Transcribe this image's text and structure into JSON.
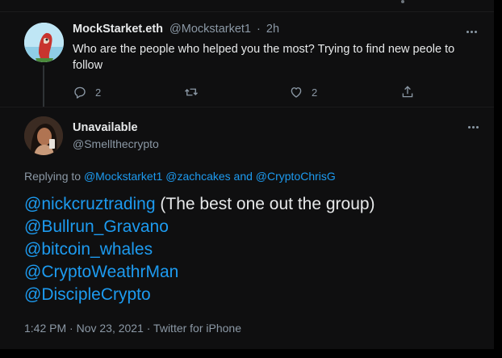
{
  "parent_tweet": {
    "display_name": "MockStarket.eth",
    "handle": "@Mockstarket1",
    "separator": "·",
    "time": "2h",
    "text": "Who are the people who helped you the most? Trying to find new peole to follow",
    "reply_count": "2",
    "retweet_count": "",
    "like_count": "2"
  },
  "reply_tweet": {
    "display_name": "Unavailable",
    "handle": "@Smellthecrypto",
    "replying_prefix": "Replying to",
    "replying_users": "@Mockstarket1 @zachcakes and @CryptoChrisG",
    "lines": [
      {
        "mention": "@nickcruztrading",
        "text": " (The best one out the group)"
      },
      {
        "mention": "@Bullrun_Gravano",
        "text": ""
      },
      {
        "mention": "@bitcoin_whales",
        "text": ""
      },
      {
        "mention": "@CryptoWeathrMan",
        "text": ""
      },
      {
        "mention": "@DiscipleCrypto",
        "text": ""
      }
    ],
    "timestamp": "1:42 PM · Nov 23, 2021 · Twitter for iPhone"
  },
  "icons": {
    "reply": "reply-icon",
    "retweet": "retweet-icon",
    "like": "heart-icon",
    "share": "share-icon",
    "more": "more-icon"
  },
  "colors": {
    "background": "#000000",
    "card": "#0f0f10",
    "link": "#1d9bf0",
    "text": "#e7e9ea",
    "muted": "#8b98a5"
  }
}
